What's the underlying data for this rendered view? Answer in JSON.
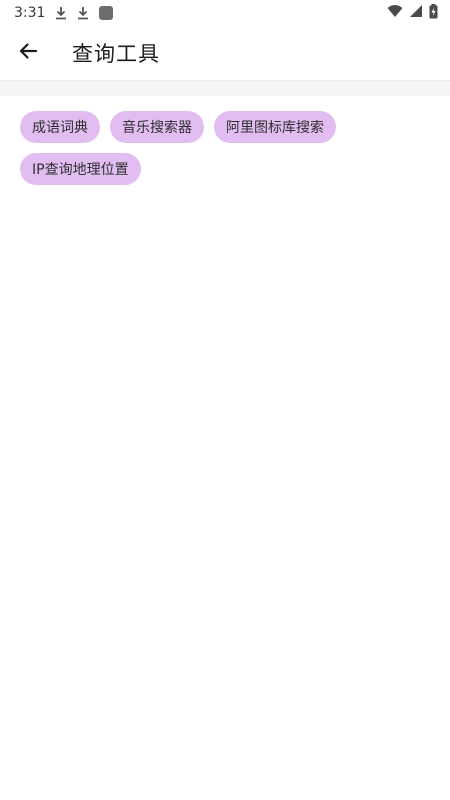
{
  "status_bar": {
    "time": "3:31",
    "icons": [
      "download-icon",
      "download-icon",
      "app-notification-icon",
      "wifi-icon",
      "signal-icon",
      "battery-charging-icon"
    ]
  },
  "app_bar": {
    "back_icon": "arrow-left-icon",
    "title": "查询工具"
  },
  "chips": [
    {
      "label": "成语词典"
    },
    {
      "label": "音乐搜索器"
    },
    {
      "label": "阿里图标库搜索"
    },
    {
      "label": "IP查询地理位置"
    }
  ],
  "colors": {
    "chip_background": "#e2bdf2",
    "divider": "#f5f5f5"
  }
}
